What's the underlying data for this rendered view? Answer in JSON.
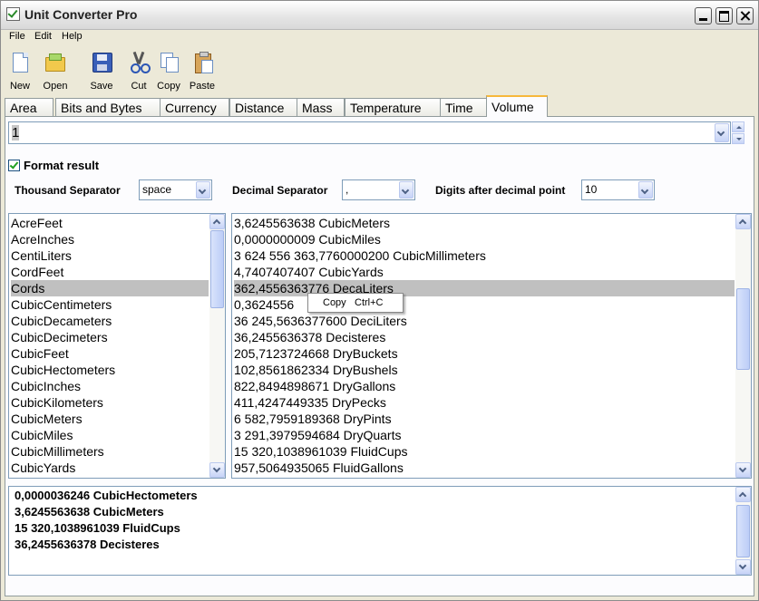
{
  "window": {
    "title": "Unit Converter Pro"
  },
  "menu": [
    "File",
    "Edit",
    "Help"
  ],
  "toolbar": {
    "new": "New",
    "open": "Open",
    "save": "Save",
    "cut": "Cut",
    "copy": "Copy",
    "paste": "Paste"
  },
  "tabs": [
    "Area",
    "Bits and Bytes",
    "Currency",
    "Distance",
    "Mass",
    "Temperature",
    "Time",
    "Volume"
  ],
  "active_tab": "Volume",
  "input": {
    "value": "1"
  },
  "options": {
    "format_result_label": "Format result",
    "format_result_checked": true,
    "thousand_separator_label": "Thousand Separator",
    "thousand_separator_value": "space",
    "decimal_separator_label": "Decimal Separator",
    "decimal_separator_value": ",",
    "digits_label": "Digits after decimal point",
    "digits_value": "10"
  },
  "units": [
    "AcreFeet",
    "AcreInches",
    "CentiLiters",
    "CordFeet",
    "Cords",
    "CubicCentimeters",
    "CubicDecameters",
    "CubicDecimeters",
    "CubicFeet",
    "CubicHectometers",
    "CubicInches",
    "CubicKilometers",
    "CubicMeters",
    "CubicMiles",
    "CubicMillimeters",
    "CubicYards"
  ],
  "selected_unit": "Cords",
  "results": [
    "3,6245563638 CubicMeters",
    "0,0000000009 CubicMiles",
    "3 624 556 363,7760000200 CubicMillimeters",
    "4,7407407407 CubicYards",
    "362,4556363776 DecaLiters",
    "0,3624556",
    "36 245,5636377600 DeciLiters",
    "36,2455636378 Decisteres",
    "205,7123724668 DryBuckets",
    "102,8561862334 DryBushels",
    "822,8494898671 DryGallons",
    "411,4247449335 DryPecks",
    "6 582,7959189368 DryPints",
    "3 291,3979594684 DryQuarts",
    "15 320,1038961039 FluidCups",
    "957,5064935065 FluidGallons"
  ],
  "selected_result": 4,
  "context_menu": {
    "item": "Copy",
    "shortcut": "Ctrl+C"
  },
  "summary": [
    "0,0000036246 CubicHectometers",
    "3,6245563638 CubicMeters",
    "15 320,1038961039 FluidCups",
    "36,2455636378 Decisteres"
  ]
}
